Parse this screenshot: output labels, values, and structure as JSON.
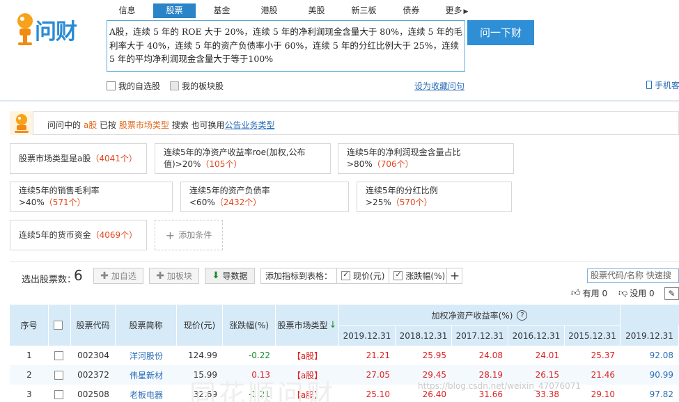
{
  "logo": {
    "text": "问财"
  },
  "nav": {
    "tabs": [
      "信息",
      "股票",
      "基金",
      "港股",
      "美股",
      "新三板",
      "债券",
      "更多"
    ],
    "active_index": 1
  },
  "query": {
    "text": "A股，连续 5 年的 ROE 大于 20%，连续 5 年的净利润现金含量大于 80%，连续 5 年的毛利率大于 40%，连续 5 年的资产负债率小于 60%，连续 5 年的分红比例大于 25%，连续 5 年的平均净利润现金含量大于等于100%"
  },
  "ask_button": "问一下财",
  "options": {
    "my_stocks": "我的自选股",
    "my_sectors": "我的板块股",
    "save_query": "设为收藏问句"
  },
  "mobile_link": "手机客",
  "notice": {
    "p1": "问问中的",
    "market": "a股",
    "p2": "已按",
    "type": "股票市场类型",
    "p3": "搜索  也可换用",
    "alt": "公告业务类型"
  },
  "conditions": [
    {
      "text": "股票市场类型是a股",
      "count": "（4041个）"
    },
    {
      "text": "连续5年的净资产收益率roe(加权,公布值)>20%",
      "count": "（105个）"
    },
    {
      "text": "连续5年的净利润现金含量占比>80%",
      "count": "（706个）"
    },
    {
      "text": "连续5年的销售毛利率>40%",
      "count": "（571个）"
    },
    {
      "text": "连续5年的资产负债率<60%",
      "count": "（2432个）"
    },
    {
      "text": "连续5年的分红比例>25%",
      "count": "（570个）"
    },
    {
      "text": "连续5年的货币资金",
      "count": "（4069个）"
    }
  ],
  "add_condition": "添加条件",
  "toolbar": {
    "selected_label": "选出股票数：",
    "selected_count": "6",
    "add_watch": "加自选",
    "add_sector": "加板块",
    "export": "导数据",
    "add_indicator": "添加指标到表格：",
    "ind_price": "现价(元)",
    "ind_change": "涨跌幅(%)",
    "plus": "+",
    "search_placeholder": "股票代码/名称 快速搜",
    "useful": "有用",
    "useful_count": "0",
    "useless": "没用",
    "useless_count": "0"
  },
  "table": {
    "headers": {
      "seq": "序号",
      "code": "股票代码",
      "name": "股票简称",
      "price": "现价(元)",
      "change": "涨跌幅(%)",
      "market": "股票市场类型",
      "roe_group": "加权净资产收益率(%)",
      "help": "?"
    },
    "years": [
      "2019.12.31",
      "2018.12.31",
      "2017.12.31",
      "2016.12.31",
      "2015.12.31",
      "2019.12.31"
    ],
    "rows": [
      {
        "seq": "1",
        "code": "002304",
        "name": "洋河股份",
        "price": "124.99",
        "change": "-0.22",
        "market": "【a股】",
        "v": [
          "21.21",
          "25.95",
          "24.08",
          "24.01",
          "25.37",
          "92.08"
        ]
      },
      {
        "seq": "2",
        "code": "002372",
        "name": "伟星新材",
        "price": "15.99",
        "change": "0.13",
        "market": "【a股】",
        "v": [
          "27.05",
          "29.45",
          "28.19",
          "26.15",
          "21.46",
          "90.99"
        ]
      },
      {
        "seq": "3",
        "code": "002508",
        "name": "老板电器",
        "price": "32.69",
        "change": "-1.21",
        "market": "【a股】",
        "v": [
          "25.10",
          "26.40",
          "31.66",
          "33.38",
          "29.10",
          "97.82"
        ]
      }
    ]
  },
  "watermark": "https://blog.csdn.net/weixin_47076071",
  "big_watermark": "同花顺问财"
}
